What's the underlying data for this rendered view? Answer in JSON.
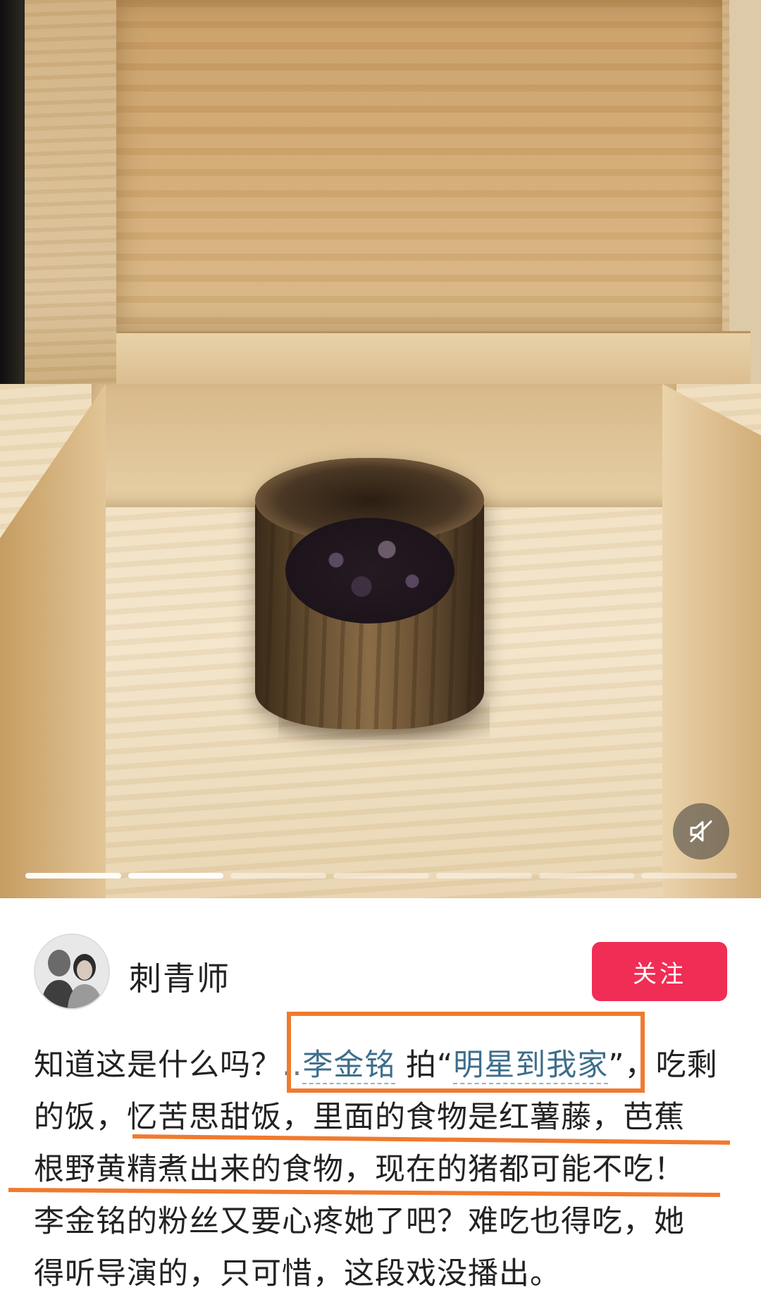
{
  "media": {
    "progress_segments": 7,
    "active_segments": 2,
    "mute_icon": "speaker-muted-icon"
  },
  "author": {
    "name": "刺青师",
    "follow_label": "关注",
    "accent_color": "#f02d55"
  },
  "post": {
    "line1_prefix": "知道这是什么吗？",
    "ellipsis": "..",
    "mention_name": "李金铭",
    "line1_mid": " 拍“",
    "show_title": "明星到我家",
    "line1_suffix": "”，吃剩",
    "line2": "的饭，忆苦思甜饭，里面的食物是红薯藤，芭蕉",
    "line3": "根野黄精煮出来的食物，现在的猪都可能不吃！",
    "line4": "李金铭的粉丝又要心疼她了吧？难吃也得吃，她",
    "line5": "得听导演的，只可惜，这段戏没播出。"
  },
  "annotations": {
    "highlight_color": "#f07a2e"
  }
}
